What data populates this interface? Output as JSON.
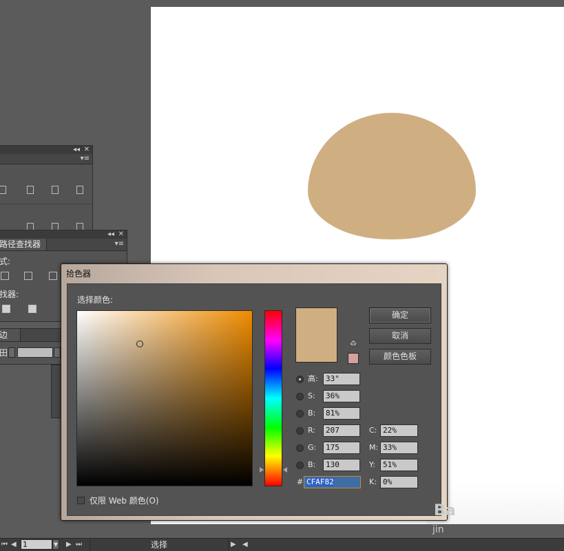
{
  "colors": {
    "fill": "#cfaf82",
    "accent": "#c88a3a",
    "hue_marker": "#a8a8a8"
  },
  "pathfinder_panel": {
    "tab_label": "路径查找器",
    "shape_modes_label": "式:",
    "pathfinders_label": "找器:"
  },
  "stroke_panel": {
    "tab_label": "边",
    "weight_label": "田:"
  },
  "color_picker": {
    "title": "拾色器",
    "select_color_label": "选择颜色:",
    "hue_marker_fraction": 0.908,
    "picker_point": {
      "saturation_pct": 36,
      "brightness_pct": 81
    },
    "buttons": {
      "ok": "确定",
      "cancel": "取消",
      "swatches": "颜色色板"
    },
    "hsb": [
      {
        "label": "高:",
        "value": "33°"
      },
      {
        "label": "S:",
        "value": "36%"
      },
      {
        "label": "B:",
        "value": "81%"
      }
    ],
    "rgb": [
      {
        "label": "R:",
        "value": "207"
      },
      {
        "label": "G:",
        "value": "175"
      },
      {
        "label": "B:",
        "value": "130"
      }
    ],
    "cmyk": [
      {
        "label": "C:",
        "value": "22%"
      },
      {
        "label": "M:",
        "value": "33%"
      },
      {
        "label": "Y:",
        "value": "51%"
      },
      {
        "label": "K:",
        "value": "0%"
      }
    ],
    "hex_prefix": "#",
    "hex_value": "CFAF82",
    "web_only_label": "仅限 Web 颜色(O)"
  },
  "statusbar": {
    "page_number": "1",
    "tool_label": "选择"
  },
  "watermark": {
    "line1": "Ba",
    "line2": "jin"
  }
}
